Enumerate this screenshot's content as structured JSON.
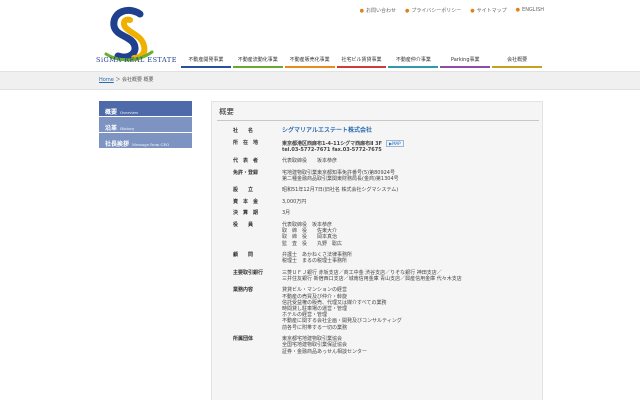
{
  "brand": {
    "logo_text": "SiGMA REAL ESTATE",
    "colors": {
      "blue": "#1f3f8f",
      "gold": "#f0b000",
      "green": "#6ab02e"
    }
  },
  "utility_nav": [
    {
      "label": "お問い合わせ"
    },
    {
      "label": "プライバシーポリシー"
    },
    {
      "label": "サイトマップ"
    },
    {
      "label": "ENGLISH"
    }
  ],
  "global_nav": [
    {
      "label": "不動産開発事業",
      "color": "#2a4ea0"
    },
    {
      "label": "不動産流動化事業",
      "color": "#6aa832"
    },
    {
      "label": "不動産販売化事業",
      "color": "#e88a20"
    },
    {
      "label": "社宅ビル賃貸事業",
      "color": "#d23a3a"
    },
    {
      "label": "不動産仲介事業",
      "color": "#2e9aa8"
    },
    {
      "label": "Parking事業",
      "color": "#8a4ea8"
    },
    {
      "label": "会社概要",
      "color": "#c8a020"
    }
  ],
  "breadcrumb": {
    "home": "Home",
    "sep": "＞",
    "current": "会社概要 概要"
  },
  "sidebar": [
    {
      "ja": "概要",
      "en": "Overview"
    },
    {
      "ja": "沿革",
      "en": "History"
    },
    {
      "ja": "社長挨拶",
      "en": "Message from CEO"
    }
  ],
  "content": {
    "title": "概要",
    "company_label": "社　　名",
    "company": "シグマリアルエステート株式会社",
    "address_label": "所　在　地",
    "address": "東京都港区西麻布1-4-11シグマ西麻布Ⅱ 3F",
    "map_button": "MAP",
    "tel": "tel.03-5772-7671 fax.03-5772-7675",
    "rep_label": "代　表　者",
    "rep": "代表取締役　　坂本恭彦",
    "license_label": "免許・登録",
    "license_lines": [
      "宅地建物取引業東京都知事免許番号(5)第80924号",
      "第二種金融商品取引業関東財務局長(金商)第1304号"
    ],
    "founded_label": "設　　立",
    "founded": "昭和51年12月7日(旧社名 株式会社シグマシステム)",
    "capital_label": "資　本　金",
    "capital": "3,000万円",
    "fiscal_label": "決　算　期",
    "fiscal": "3月",
    "officers_label": "役　　員",
    "officers": [
      "代表取締役　坂本恭彦",
      "取　締　役　　佐東大介",
      "取　締　役　　岡本真治",
      "監　査　役　　丸野　聡広"
    ],
    "advisors_label": "顧　　問",
    "advisors": [
      "弁護士　あかねくさ法律事務所",
      "税理士　まるの税理士事務所"
    ],
    "banks_label": "主要取引銀行",
    "banks": [
      "三菱ＵＦＪ銀行 赤坂支店／商工中金 渋谷支店／りそな銀行 神田支店／",
      "三井住友銀行 新宿西口支店／城南信用金庫 青山支店／興産信用金庫 代々木支店"
    ],
    "business_label": "業務内容",
    "business": [
      "貸貸ビル・マンションの経営",
      "不動産の売買及び仲介・斡旋",
      "信託受益権の販売、代理又は媒介すべての業務",
      "時間貸し駐車場の運営・管理",
      "ホテルの経営・管理",
      "不動産に関する会社企画・開発及びコンサルティング",
      "前各号に附帯する一切の業務"
    ],
    "groups_label": "所属団体",
    "groups": [
      "東京都宅地建物取引業協会",
      "全国宅地建物取引業保証協会",
      "証券・金融商品あっせん相談センター"
    ]
  }
}
